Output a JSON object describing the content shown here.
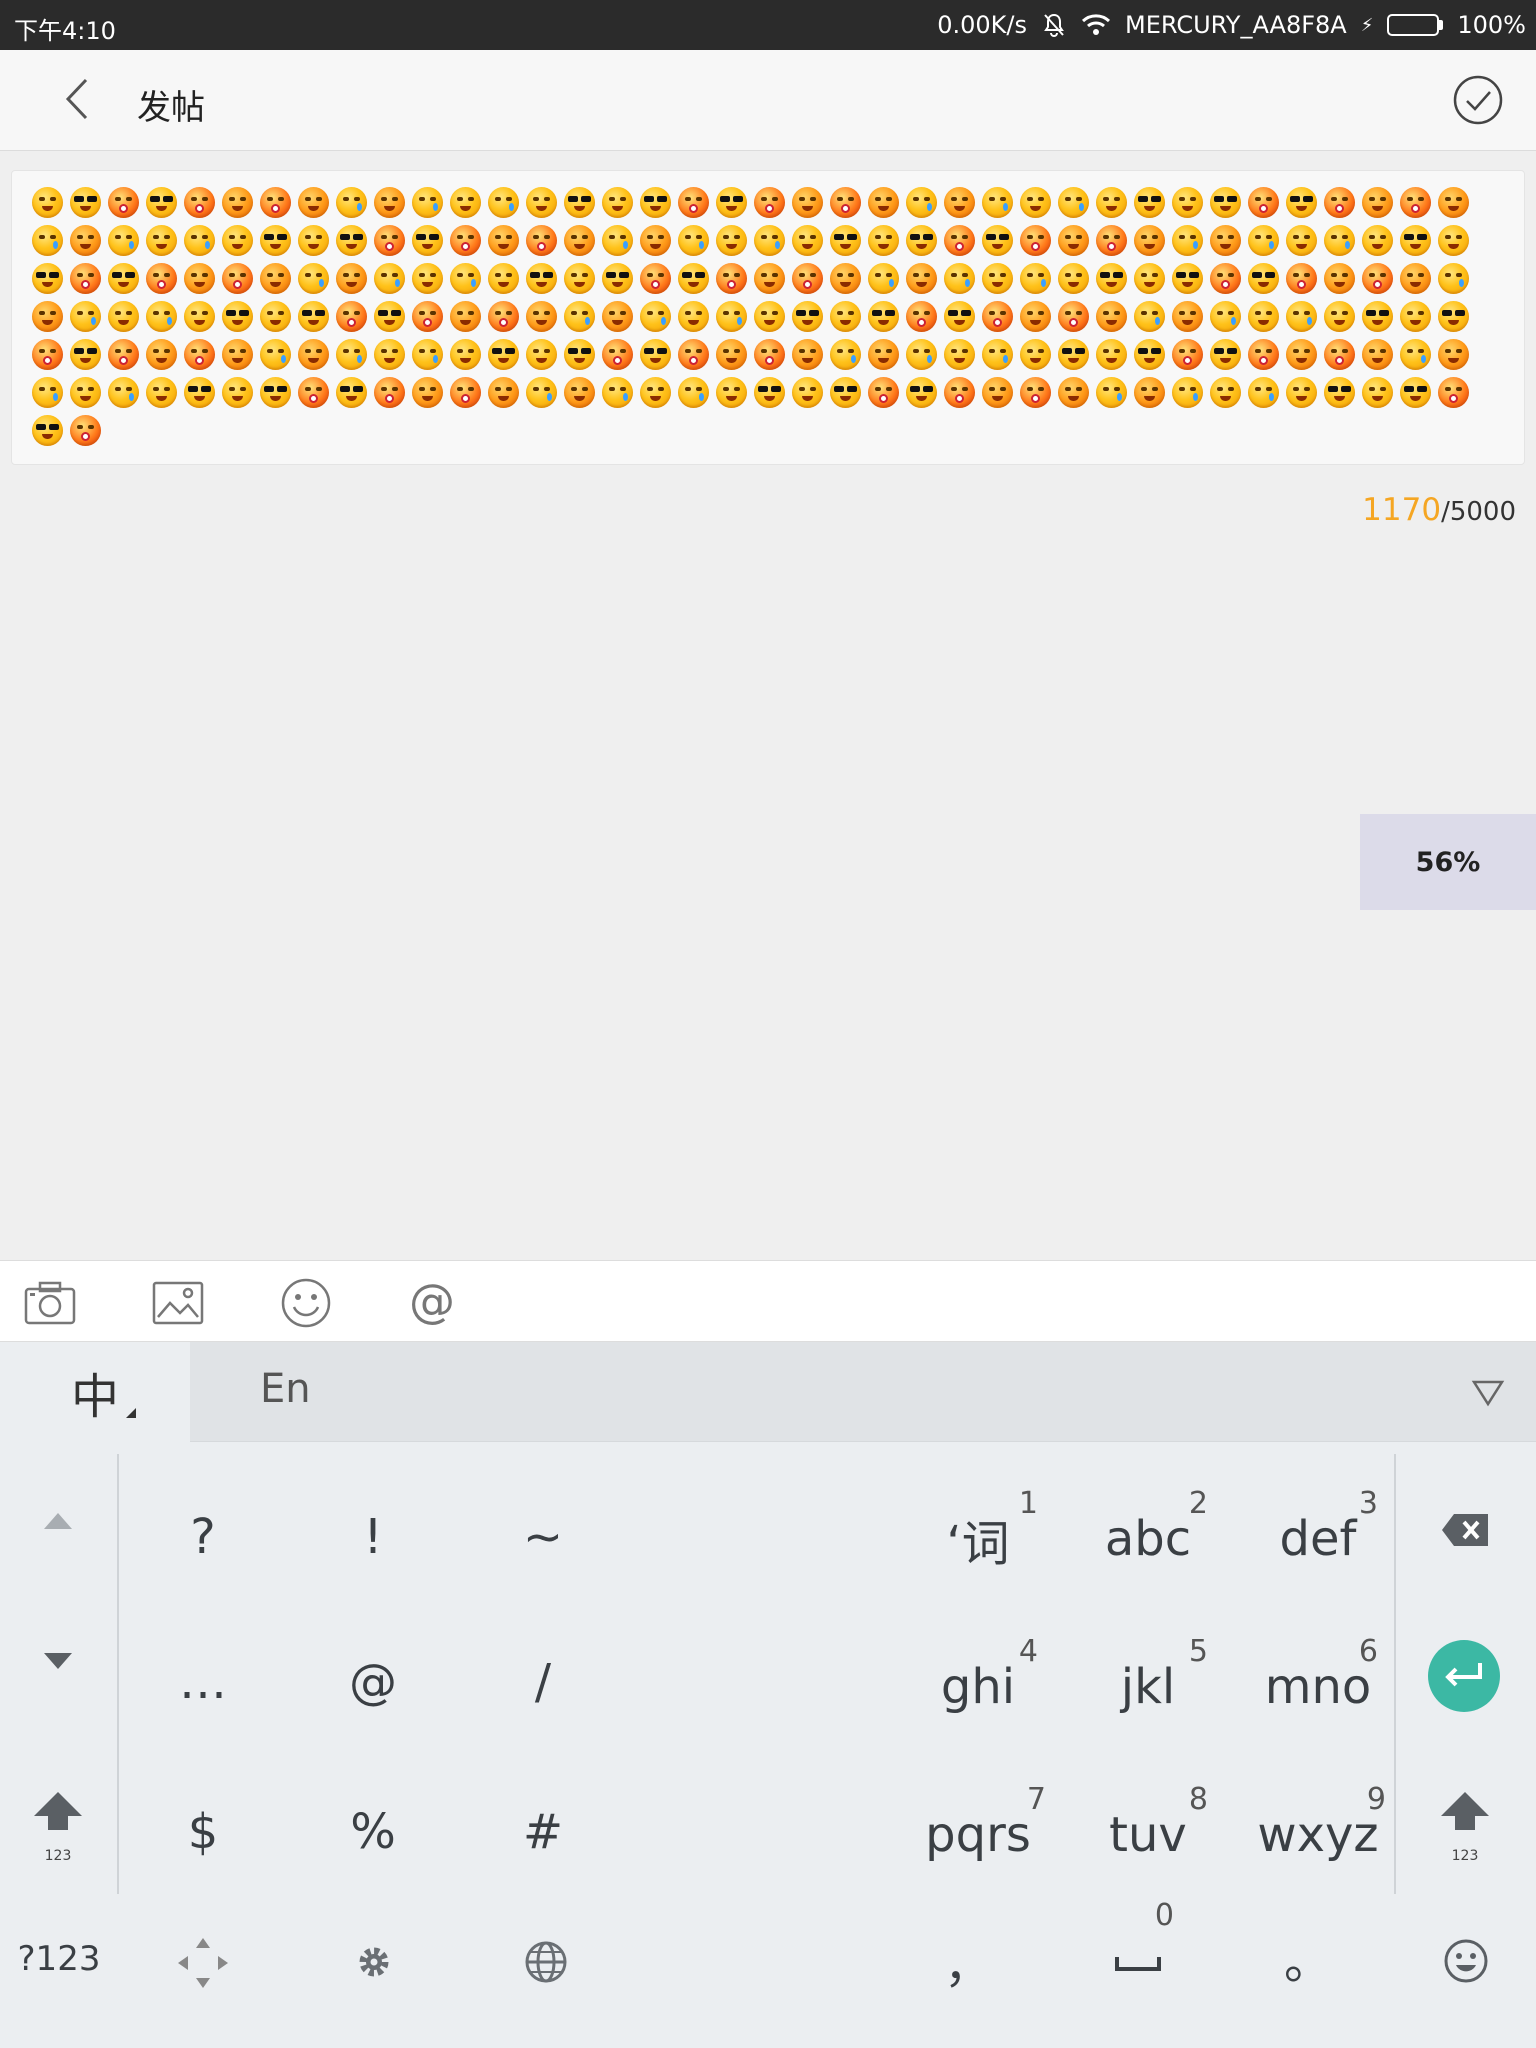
{
  "status": {
    "time": "下午4:10",
    "speed": "0.00K/s",
    "wifi_name": "MERCURY_AA8F8A",
    "battery": "100%",
    "battery_level": 1.0
  },
  "header": {
    "title": "发帖"
  },
  "editor": {
    "emoji_count_shown": 230
  },
  "counter": {
    "current": "1170",
    "limit": "/5000"
  },
  "zoom_indicator": "56%",
  "toolbar": {
    "icons": [
      "camera-icon",
      "image-icon",
      "emoji-icon",
      "at-icon"
    ]
  },
  "keyboard": {
    "lang_primary": "中",
    "lang_secondary": "En",
    "symbols_row1": [
      "?",
      "!",
      "~"
    ],
    "symbols_row2": [
      "…",
      "@",
      "/"
    ],
    "symbols_row3": [
      "$",
      "%",
      "#"
    ],
    "t9": [
      {
        "label": "‘词",
        "num": "1"
      },
      {
        "label": "abc",
        "num": "2"
      },
      {
        "label": "def",
        "num": "3"
      },
      {
        "label": "ghi",
        "num": "4"
      },
      {
        "label": "jkl",
        "num": "5"
      },
      {
        "label": "mno",
        "num": "6"
      },
      {
        "label": "pqrs",
        "num": "7"
      },
      {
        "label": "tuv",
        "num": "8"
      },
      {
        "label": "wxyz",
        "num": "9"
      }
    ],
    "shift_sub": "123",
    "mode_key": "?123",
    "comma": "，",
    "space_num": "0",
    "period": "。"
  },
  "colors": {
    "accent": "#3cb8a4",
    "counter_highlight": "#f5a623",
    "zoom_pill_bg": "#dcdbe9"
  }
}
